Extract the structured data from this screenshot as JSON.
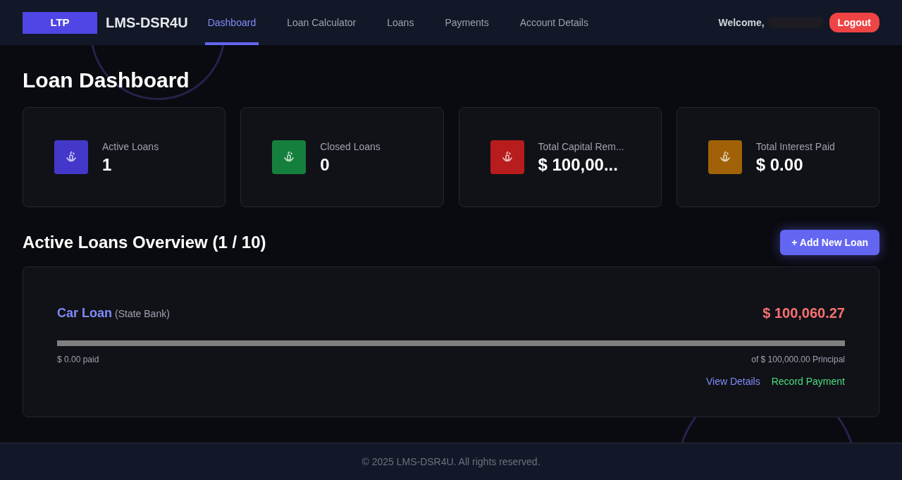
{
  "header": {
    "logo": "LTP",
    "brand": "LMS-DSR4U",
    "nav": [
      {
        "label": "Dashboard",
        "selected": true
      },
      {
        "label": "Loan Calculator",
        "selected": false
      },
      {
        "label": "Loans",
        "selected": false
      },
      {
        "label": "Payments",
        "selected": false
      },
      {
        "label": "Account Details",
        "selected": false
      }
    ],
    "welcome": "Welcome,",
    "logout": "Logout"
  },
  "title": "Loan Dashboard",
  "stats": [
    {
      "label": "Active Loans",
      "value": "1",
      "color": "#4338ca"
    },
    {
      "label": "Closed Loans",
      "value": "0",
      "color": "#15803d"
    },
    {
      "label": "Total Capital Rem...",
      "value": "$ 100,00...",
      "color": "#b91c1c"
    },
    {
      "label": "Total Interest Paid",
      "value": "$ 0.00",
      "color": "#a16207"
    }
  ],
  "overview": {
    "title": "Active Loans Overview (1 / 10)",
    "add_button": "+ Add New Loan",
    "loans": [
      {
        "name": "Car Loan",
        "bank": "(State Bank)",
        "amount": "$ 100,060.27",
        "level": 0,
        "paid": "$ 0.00 paid",
        "principal": "of $ 100,000.00 Principal",
        "view": "View Details",
        "record": "Record Payment"
      }
    ]
  },
  "footer": "© 2025 LMS-DSR4U. All rights reserved."
}
